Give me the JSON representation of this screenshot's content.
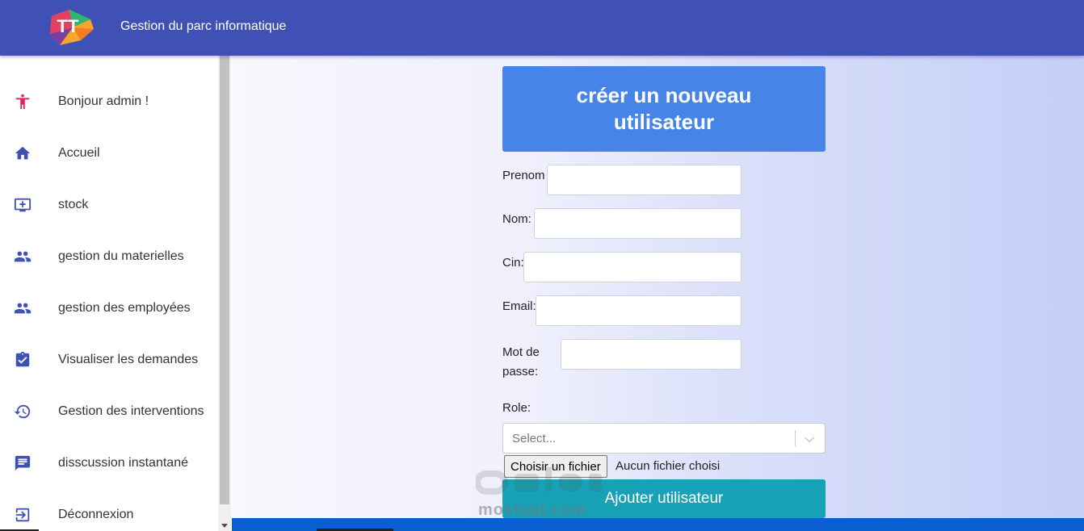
{
  "header": {
    "title": "Gestion du parc informatique",
    "logo_text": "TT"
  },
  "sidebar": {
    "items": [
      {
        "label": "Bonjour admin !",
        "icon": "person-icon"
      },
      {
        "label": "Accueil",
        "icon": "home-icon"
      },
      {
        "label": "stock",
        "icon": "monitor-add-icon"
      },
      {
        "label": "gestion du materielles",
        "icon": "people-icon"
      },
      {
        "label": "gestion des employées",
        "icon": "people-icon"
      },
      {
        "label": "Visualiser les demandes",
        "icon": "clipboard-check-icon"
      },
      {
        "label": "Gestion des interventions",
        "icon": "history-icon"
      },
      {
        "label": "disscussion instantané",
        "icon": "chat-icon"
      },
      {
        "label": "Déconnexion",
        "icon": "logout-icon"
      }
    ]
  },
  "form": {
    "title": "créer un nouveau utilisateur",
    "fields": {
      "prenom": {
        "label": "Prenom",
        "value": ""
      },
      "nom": {
        "label": "Nom:",
        "value": ""
      },
      "cin": {
        "label": "Cin:",
        "value": ""
      },
      "email": {
        "label": "Email:",
        "value": ""
      },
      "password": {
        "label": "Mot de passe:",
        "value": ""
      }
    },
    "role_label": "Role:",
    "role_placeholder": "Select...",
    "file_button": "Choisir un fichier",
    "file_status": "Aucun fichier choisi",
    "submit_label": "Ajouter utilisateur"
  },
  "watermark": {
    "text": "mostaql.com"
  },
  "colors": {
    "topbar": "#3f51b5",
    "sidebar_icon": "#3f51b5",
    "person_icon": "#e91e63",
    "header_button": "#4684e8",
    "submit_button": "#17a2b8"
  }
}
